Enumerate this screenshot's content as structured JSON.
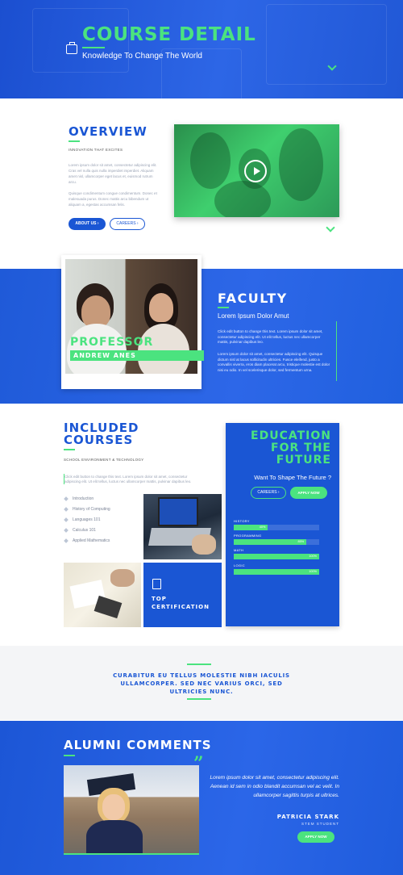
{
  "hero": {
    "title": "COURSE DETAIL",
    "subtitle": "Knowledge To Change The World",
    "icon": "briefcase-icon"
  },
  "overview": {
    "title": "OVERVIEW",
    "kicker": "INNOVATION THAT EXCITES",
    "para1": "Lorem ipsum dolor sit amet, consectetur adipiscing elit. Cras vel nulla quis nulla imperdiet imperdiet. Aliquam amet nisl, ullamcorper eget lacus et, euismod rutrum arcu.",
    "para2": "Quisque condimentum congue condimentum. Donec et malesuada purus. Donec mattis arcu bibendum ut aliquam a, egestas accumsan felis.",
    "btn_primary": "ABOUT US ›",
    "btn_secondary": "CAREERS ›"
  },
  "faculty": {
    "title": "FACULTY",
    "subtitle": "Lorem Ipsum Dolor Amut",
    "para1": "Click edit button to change this text. Lorem ipsum dolor sit amet, consectetur adipiscing elit. Ut elit tellus, luctus nec ullamcorper mattis, pulvinar dapibus leo.",
    "para2": "Lorem ipsum dolor sit amet, consectetur adipiscing elit. Quisque dictum nisl at lacus sollicitudin ultricies. Fusce eleifend, justo a convallis viverra, eros diam placerat arcu, tristique molestie est dolor nisi eu odio. In vel scelerisque dolor, sed fermentum urna.",
    "professor_label": "PROFESSOR",
    "professor_name": "ANDREW ANES"
  },
  "courses": {
    "title_line1": "INCLUDED",
    "title_line2": "COURSES",
    "kicker": "SCHOOL ENVIRONMENT & TECHNOLOGY",
    "para": "Click edit button to change this text. Lorem ipsum dolor sit amet, consectetur adipiscing elit. Ut elit tellus, luctus nec ullamcorper mattis, pulvinar dapibus leo.",
    "items": [
      "Introduction",
      "History of Computing",
      "Languages 101",
      "Calculus 101",
      "Applied Mathematics"
    ],
    "cert_line1": "TOP",
    "cert_line2": "CERTIFICATION"
  },
  "education": {
    "title_line1": "EDUCATION",
    "title_line2": "FOR THE",
    "title_line3": "FUTURE",
    "subtitle": "Want To Shape The Future ?",
    "btn_outline": "CAREERS ›",
    "btn_solid": "APPLY NOW",
    "skills": [
      {
        "label": "HISTORY",
        "value": 40,
        "text": "40%"
      },
      {
        "label": "PROGRAMMING",
        "value": 85,
        "text": "85%"
      },
      {
        "label": "MATH",
        "value": 100,
        "text": "100%"
      },
      {
        "label": "LOGIC",
        "value": 100,
        "text": "100%"
      }
    ]
  },
  "quote": {
    "text": "CURABITUR EU TELLUS MOLESTIE NIBH IACULIS ULLAMCORPER. SED NEC VARIUS ORCI, SED ULTRICIES NUNC."
  },
  "alumni": {
    "title": "ALUMNI COMMENTS",
    "quote": "Lorem ipsum dolor sit amet, consectetur adipiscing elit. Aenean id sem in odio blandit accumsan vel ac velit. In ullamcorper sagittis turpis at ultrices.",
    "name": "PATRICIA STARK",
    "role": "STEM STUDENT",
    "btn": "APPLY NOW"
  },
  "colors": {
    "brand_blue": "#1a56d4",
    "accent_green": "#4be37f"
  }
}
